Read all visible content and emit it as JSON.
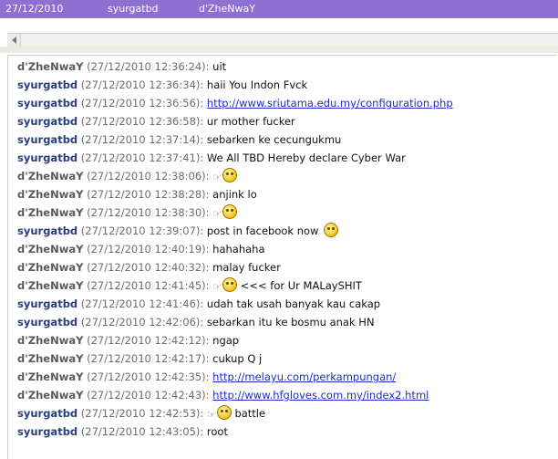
{
  "list_row": {
    "date": "27/12/2010",
    "user": "syurgatbd",
    "other": "d'ZheNwaY"
  },
  "chat": [
    {
      "nick": "d'ZheNwaY",
      "ts": "(27/12/2010 12:36:24):",
      "text": "uit",
      "who": "dz"
    },
    {
      "nick": "syurgatbd",
      "ts": "(27/12/2010 12:36:34):",
      "text": "haii You Indon Fvck",
      "who": "sy"
    },
    {
      "nick": "syurgatbd",
      "ts": "(27/12/2010 12:36:56):",
      "text": "http://www.sriutama.edu.my/configuration.php",
      "who": "sy",
      "link": true
    },
    {
      "nick": "syurgatbd",
      "ts": "(27/12/2010 12:36:58):",
      "text": "ur mother fucker",
      "who": "sy"
    },
    {
      "nick": "syurgatbd",
      "ts": "(27/12/2010 12:37:14):",
      "text": "sebarken ke cecungukmu",
      "who": "sy"
    },
    {
      "nick": "syurgatbd",
      "ts": "(27/12/2010 12:37:41):",
      "text": "We All TBD Hereby declare Cyber War",
      "who": "sy"
    },
    {
      "nick": "d'ZheNwaY",
      "ts": "(27/12/2010 12:38:06):",
      "text": "",
      "who": "dz",
      "emoticon": "hand-smiley"
    },
    {
      "nick": "d'ZheNwaY",
      "ts": "(27/12/2010 12:38:28):",
      "text": "anjink lo",
      "who": "dz"
    },
    {
      "nick": "d'ZheNwaY",
      "ts": "(27/12/2010 12:38:30):",
      "text": "",
      "who": "dz",
      "emoticon": "hand-smiley"
    },
    {
      "nick": "syurgatbd",
      "ts": "(27/12/2010 12:39:07):",
      "text": "post in facebook now",
      "who": "sy",
      "emoticon_after": true
    },
    {
      "nick": "d'ZheNwaY",
      "ts": "(27/12/2010 12:40:19):",
      "text": "hahahaha",
      "who": "dz"
    },
    {
      "nick": "d'ZheNwaY",
      "ts": "(27/12/2010 12:40:32):",
      "text": "malay fucker",
      "who": "dz"
    },
    {
      "nick": "d'ZheNwaY",
      "ts": "(27/12/2010 12:41:45):",
      "text": "<<< for Ur MALaySHIT",
      "who": "dz",
      "emoticon": "hand-smiley"
    },
    {
      "nick": "syurgatbd",
      "ts": "(27/12/2010 12:41:46):",
      "text": "udah tak usah banyak kau cakap",
      "who": "sy"
    },
    {
      "nick": "syurgatbd",
      "ts": "(27/12/2010 12:42:06):",
      "text": "sebarkan itu ke bosmu anak HN",
      "who": "sy"
    },
    {
      "nick": "d'ZheNwaY",
      "ts": "(27/12/2010 12:42:12):",
      "text": "ngap",
      "who": "dz"
    },
    {
      "nick": "d'ZheNwaY",
      "ts": "(27/12/2010 12:42:17):",
      "text": "cukup Q j",
      "who": "dz"
    },
    {
      "nick": "d'ZheNwaY",
      "ts": "(27/12/2010 12:42:35):",
      "text": "http://melayu.com/perkampungan/",
      "who": "dz",
      "link": true
    },
    {
      "nick": "d'ZheNwaY",
      "ts": "(27/12/2010 12:42:43):",
      "text": "http://www.hfgloves.com.my/index2.html",
      "who": "dz",
      "link": true
    },
    {
      "nick": "syurgatbd",
      "ts": "(27/12/2010 12:42:53):",
      "text": "battle",
      "who": "sy",
      "emoticon": "hand-smiley"
    },
    {
      "nick": "syurgatbd",
      "ts": "(27/12/2010 12:43:05):",
      "text": "root",
      "who": "sy"
    }
  ]
}
